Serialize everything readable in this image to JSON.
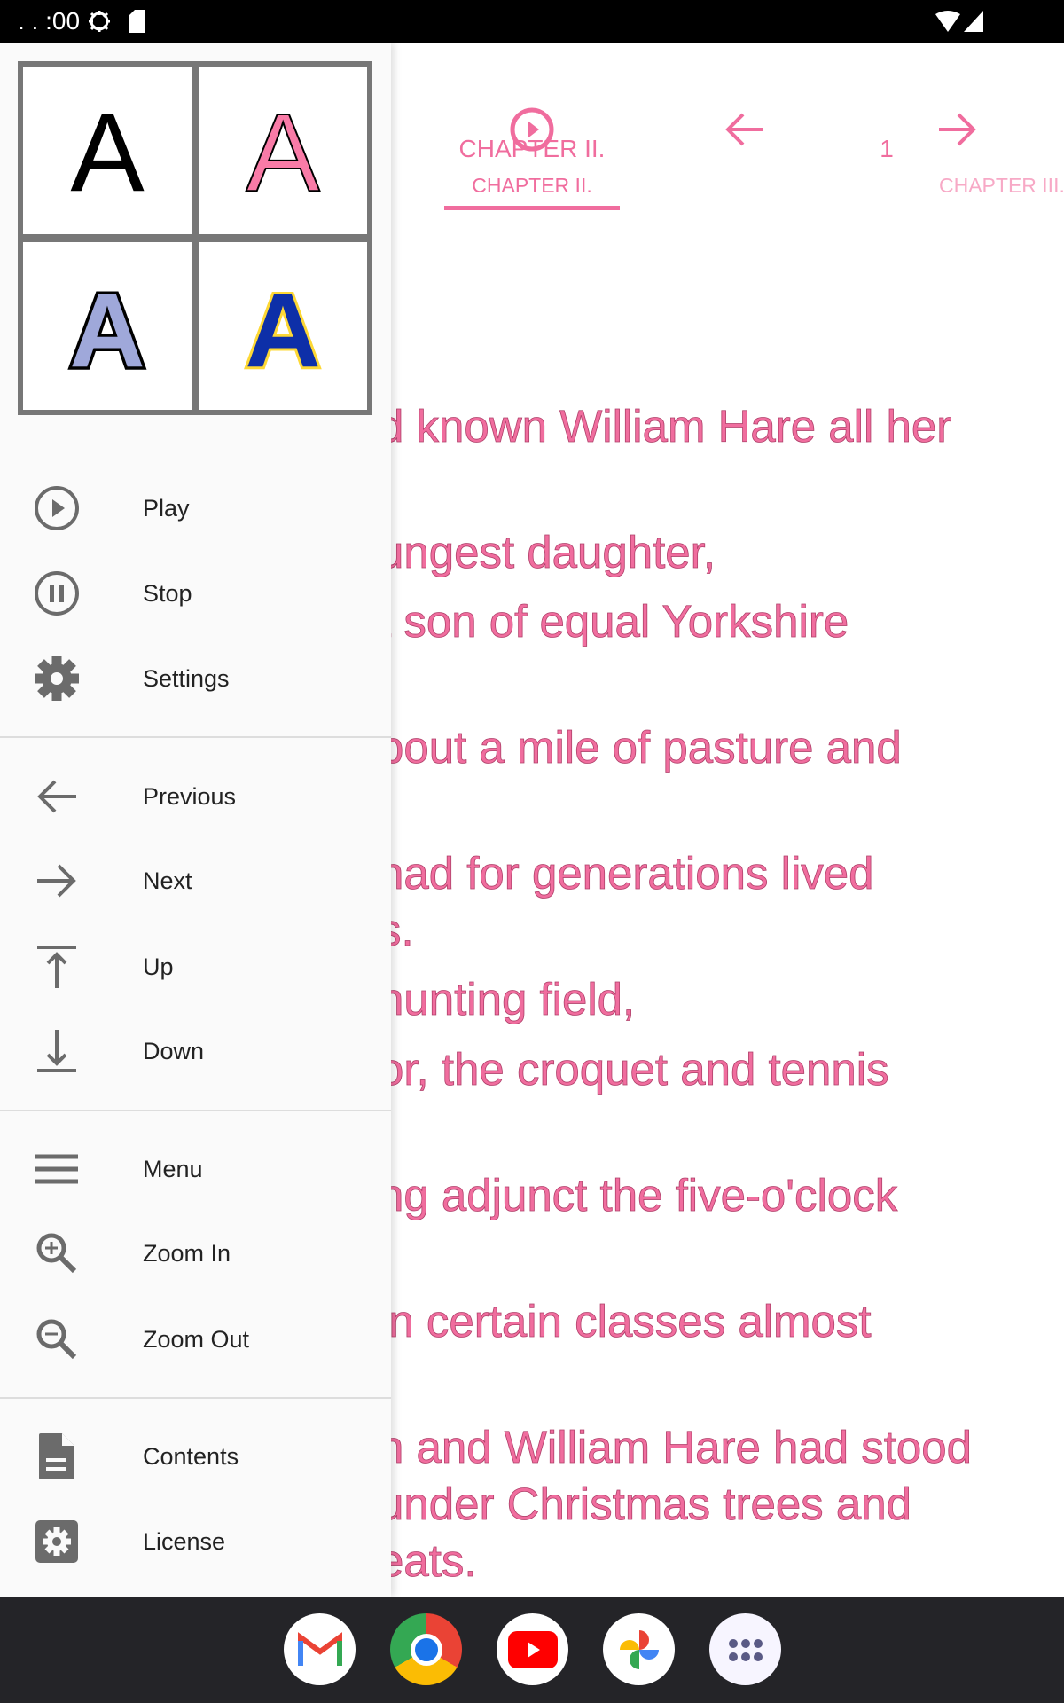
{
  "status": {
    "time": ". . :00"
  },
  "toolbar": {
    "title": "CHAPTER II.",
    "page": "1",
    "tabs": [
      {
        "label": "CHAPTER II.",
        "selected": true
      },
      {
        "label": "CHAPTER III.",
        "selected": false
      }
    ]
  },
  "colors": {
    "accent": "#f06d9e",
    "drawer_bg": "#fafafa",
    "nav_bg": "#242428"
  },
  "body_lines": [
    "d known William Hare all her",
    "ungest daughter,",
    "t son of equal Yorkshire",
    "bout a mile of pasture and",
    "had for generations lived",
    "s.",
    "hunting field,",
    "or, the croquet and tennis",
    "ng adjunct the five-o'clock",
    "in certain classes almost",
    "n and William Hare had stood",
    "under Christmas trees and",
    "eats."
  ],
  "font_samples": {
    "letter": "A"
  },
  "drawer": {
    "items": [
      {
        "label": "Play",
        "icon": "play-circle-icon"
      },
      {
        "label": "Stop",
        "icon": "pause-circle-icon"
      },
      {
        "label": "Settings",
        "icon": "gear-icon"
      },
      {
        "label": "Previous",
        "icon": "arrow-left-icon"
      },
      {
        "label": "Next",
        "icon": "arrow-right-icon"
      },
      {
        "label": "Up",
        "icon": "arrow-up-to-line-icon"
      },
      {
        "label": "Down",
        "icon": "arrow-down-to-line-icon"
      },
      {
        "label": "Menu",
        "icon": "menu-icon"
      },
      {
        "label": "Zoom In",
        "icon": "zoom-in-icon"
      },
      {
        "label": "Zoom Out",
        "icon": "zoom-out-icon"
      },
      {
        "label": "Contents",
        "icon": "document-icon"
      },
      {
        "label": "License",
        "icon": "settings-box-icon"
      }
    ]
  },
  "dock": [
    "Gmail",
    "Chrome",
    "YouTube",
    "Photos",
    "Apps"
  ]
}
